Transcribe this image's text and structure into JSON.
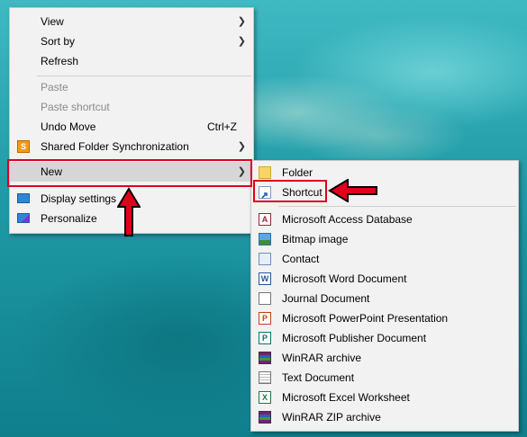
{
  "context_menu": {
    "items": [
      {
        "label": "View",
        "submenu": true
      },
      {
        "label": "Sort by",
        "submenu": true
      },
      {
        "label": "Refresh"
      },
      {
        "label": "Paste",
        "disabled": true
      },
      {
        "label": "Paste shortcut",
        "disabled": true
      },
      {
        "label": "Undo Move",
        "shortcut": "Ctrl+Z"
      },
      {
        "label": "Shared Folder Synchronization",
        "submenu": true,
        "icon": "shared-folder-sync-icon"
      },
      {
        "label": "New",
        "submenu": true,
        "highlighted": true
      },
      {
        "label": "Display settings",
        "icon": "display-settings-icon"
      },
      {
        "label": "Personalize",
        "icon": "personalize-icon"
      }
    ]
  },
  "new_submenu": {
    "items": [
      {
        "label": "Folder",
        "icon": "folder-icon"
      },
      {
        "label": "Shortcut",
        "icon": "shortcut-icon",
        "highlighted": true
      },
      {
        "label": "Microsoft Access Database",
        "icon": "access-icon"
      },
      {
        "label": "Bitmap image",
        "icon": "bitmap-icon"
      },
      {
        "label": "Contact",
        "icon": "contact-icon"
      },
      {
        "label": "Microsoft Word Document",
        "icon": "word-icon"
      },
      {
        "label": "Journal Document",
        "icon": "journal-icon"
      },
      {
        "label": "Microsoft PowerPoint Presentation",
        "icon": "powerpoint-icon"
      },
      {
        "label": "Microsoft Publisher Document",
        "icon": "publisher-icon"
      },
      {
        "label": "WinRAR archive",
        "icon": "winrar-icon"
      },
      {
        "label": "Text Document",
        "icon": "text-document-icon"
      },
      {
        "label": "Microsoft Excel Worksheet",
        "icon": "excel-icon"
      },
      {
        "label": "WinRAR ZIP archive",
        "icon": "winrar-zip-icon"
      }
    ]
  },
  "glyphs": {
    "submenu_arrow": "❯"
  },
  "colors": {
    "annotation_red": "#e0001a",
    "highlight": "#d6d6d6",
    "menu_bg": "#f2f2f2"
  }
}
